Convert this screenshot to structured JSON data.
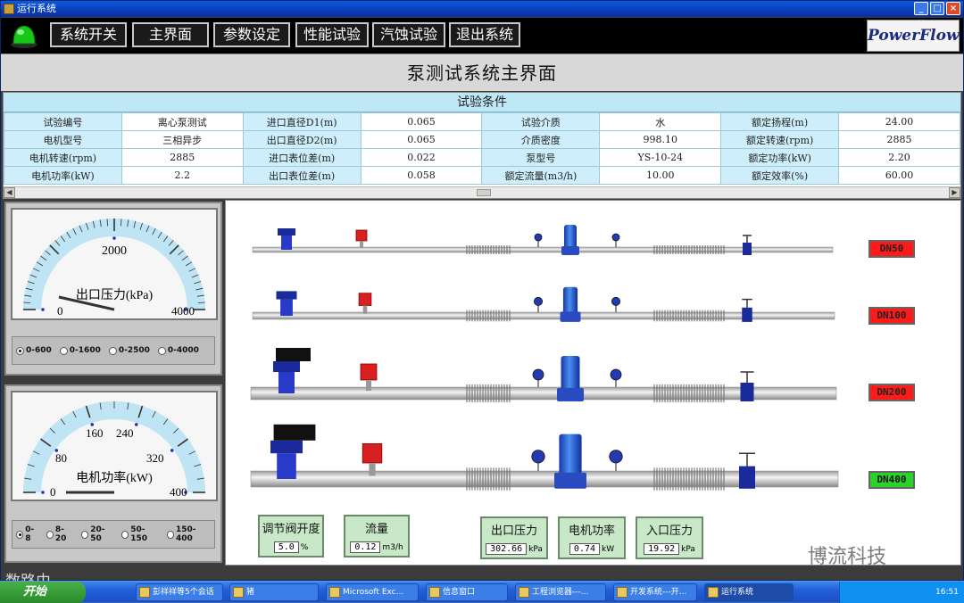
{
  "window": {
    "title": "运行系统"
  },
  "menu": {
    "items": [
      "系统开关",
      "主界面",
      "参数设定",
      "性能试验",
      "汽蚀试验",
      "退出系统"
    ],
    "logo": "PowerFlow"
  },
  "page_title": "泵测试系统主界面",
  "conditions": {
    "header": "试验条件",
    "rows": [
      [
        "试验编号",
        "离心泵测试",
        "进口直径D1(m)",
        "0.065",
        "试验介质",
        "水",
        "额定扬程(m)",
        "24.00"
      ],
      [
        "电机型号",
        "三相异步",
        "出口直径D2(m)",
        "0.065",
        "介质密度",
        "998.10",
        "额定转速(rpm)",
        "2885"
      ],
      [
        "电机转速(rpm)",
        "2885",
        "进口表位差(m)",
        "0.022",
        "泵型号",
        "YS-10-24",
        "额定功率(kW)",
        "2.20"
      ],
      [
        "电机功率(kW)",
        "2.2",
        "出口表位差(m)",
        "0.058",
        "额定流量(m3/h)",
        "10.00",
        "额定效率(%)",
        "60.00"
      ]
    ]
  },
  "gauge1": {
    "label": "出口压力(kPa)",
    "ticks": [
      "0",
      "2000",
      "4000"
    ],
    "needle_value": 0,
    "ranges": [
      "0-600",
      "0-1600",
      "0-2500",
      "0-4000"
    ],
    "selected_range": 0
  },
  "gauge2": {
    "label": "电机功率(kW)",
    "ticks": [
      "0",
      "80",
      "160",
      "240",
      "320",
      "400"
    ],
    "needle_value": 0,
    "ranges": [
      "0-8",
      "8-20",
      "20-50",
      "50-150",
      "150-400"
    ],
    "selected_range": 0
  },
  "pipelines": [
    {
      "label": "DN50",
      "color": "#ff1a1a"
    },
    {
      "label": "DN100",
      "color": "#ff1a1a"
    },
    {
      "label": "DN200",
      "color": "#ff1a1a"
    },
    {
      "label": "DN400",
      "color": "#28d428"
    }
  ],
  "readouts": [
    {
      "title": "调节阀开度",
      "value": "5.0",
      "unit": "%"
    },
    {
      "title": "流量",
      "value": "0.12",
      "unit": "m3/h"
    },
    {
      "title": "出口压力",
      "value": "302.66",
      "unit": "kPa"
    },
    {
      "title": "电机功率",
      "value": "0.74",
      "unit": "kW"
    },
    {
      "title": "入口压力",
      "value": "19.92",
      "unit": "kPa"
    }
  ],
  "watermark": "博流科技",
  "overlay_watermark": "数路由",
  "taskbar": {
    "start": "开始",
    "items": [
      "彭祥祥等5个会话",
      "猪",
      "Microsoft Exc...",
      "信息窗口",
      "工程浏览器---...",
      "开发系统---开...",
      "运行系统"
    ],
    "clock": "16:51"
  }
}
